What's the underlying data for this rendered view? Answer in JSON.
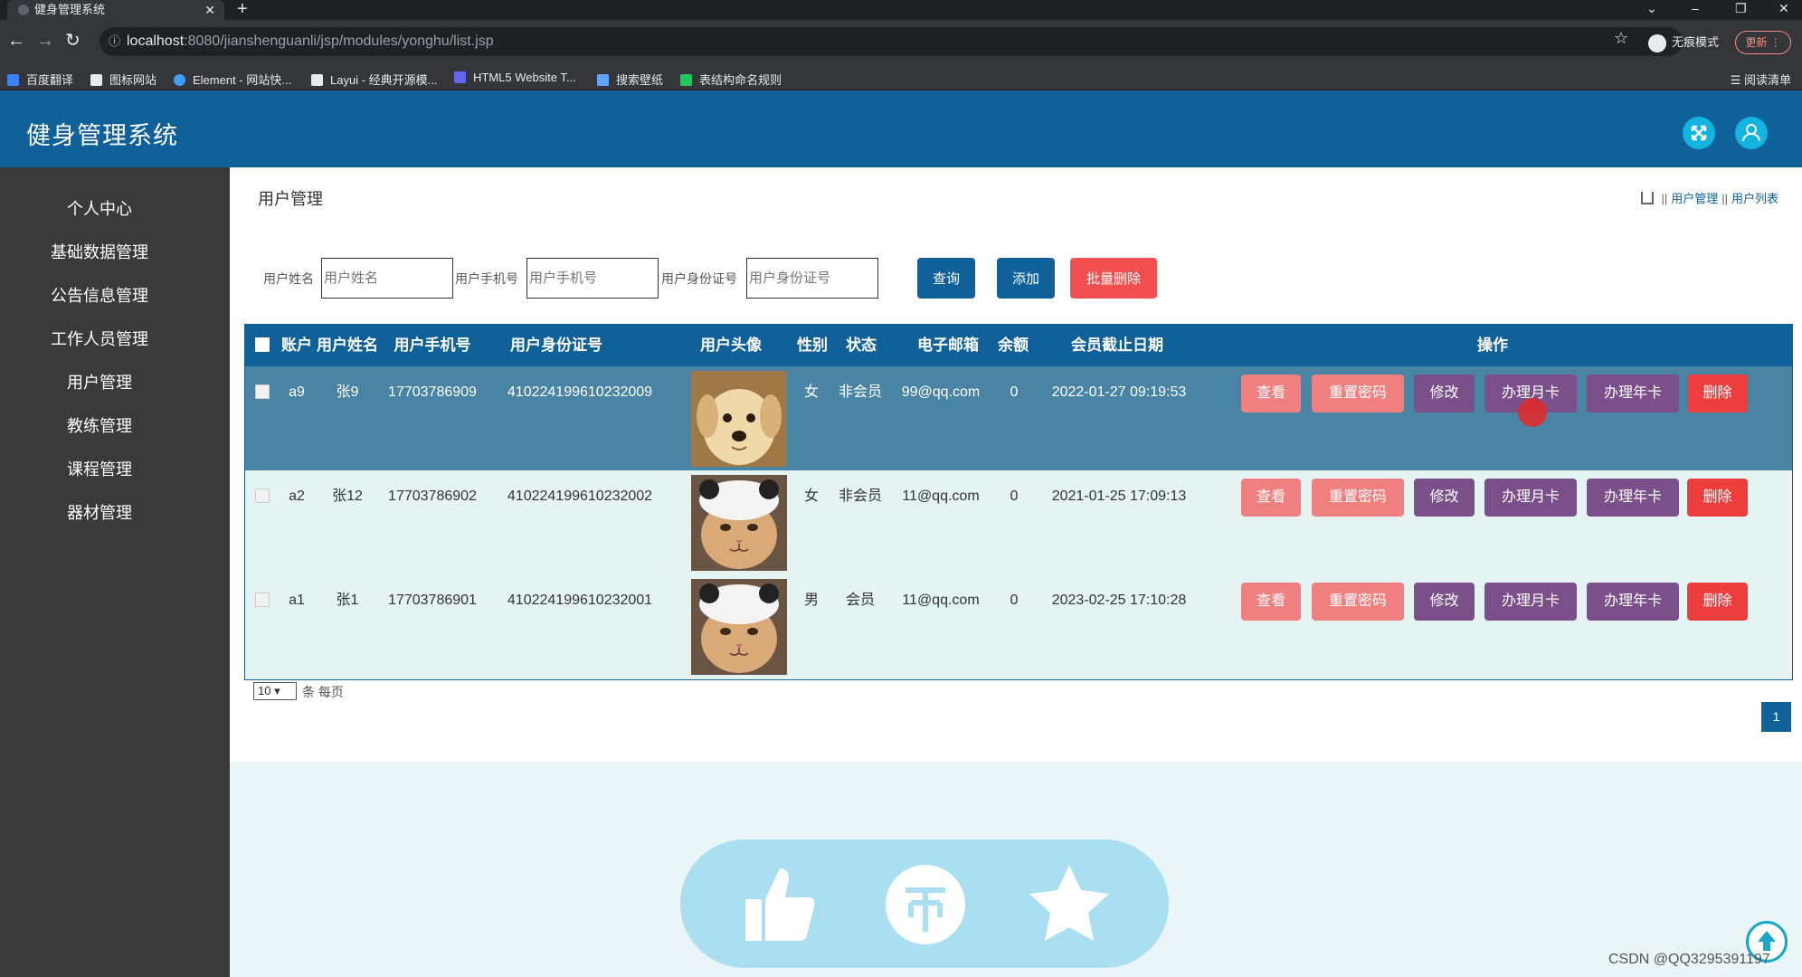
{
  "browser": {
    "tab_title": "健身管理系统",
    "tab_close": "✕",
    "new_tab": "+",
    "url_host": "localhost",
    "url_rest": ":8080/jianshenguanli/jsp/modules/yonghu/list.jsp",
    "incognito_label": "无痕模式",
    "update_label": "更新",
    "bookmarks": [
      "百度翻译",
      "图标网站",
      "Element - 网站快...",
      "Layui - 经典开源模...",
      "HTML5 Website T...",
      "搜索壁纸",
      "表结构命名规则"
    ],
    "reading_list": "阅读清单"
  },
  "app": {
    "title": "健身管理系统"
  },
  "sidebar": {
    "items": [
      {
        "label": "个人中心"
      },
      {
        "label": "基础数据管理"
      },
      {
        "label": "公告信息管理"
      },
      {
        "label": "工作人员管理"
      },
      {
        "label": "用户管理"
      },
      {
        "label": "教练管理"
      },
      {
        "label": "课程管理"
      },
      {
        "label": "器材管理"
      }
    ]
  },
  "page": {
    "title": "用户管理",
    "breadcrumb": [
      "用户管理",
      "用户列表"
    ]
  },
  "search": {
    "name_label": "用户姓名",
    "name_placeholder": "用户姓名",
    "phone_label": "用户手机号",
    "phone_placeholder": "用户手机号",
    "id_label": "用户身份证号",
    "id_placeholder": "用户身份证号",
    "query_button": "查询",
    "add_button": "添加",
    "batch_delete_button": "批量删除"
  },
  "table": {
    "headers": [
      "账户",
      "用户姓名",
      "用户手机号",
      "用户身份证号",
      "用户头像",
      "性别",
      "状态",
      "电子邮箱",
      "余额",
      "会员截止日期",
      "操作"
    ],
    "actions": [
      "查看",
      "重置密码",
      "修改",
      "办理月卡",
      "办理年卡",
      "删除"
    ],
    "rows": [
      {
        "account": "a9",
        "name": "张9",
        "phone": "17703786909",
        "id_card": "410224199610232009",
        "avatar": "puppy",
        "gender": "女",
        "status": "非会员",
        "email": "99@qq.com",
        "balance": "0",
        "expire": "2022-01-27 09:19:53"
      },
      {
        "account": "a2",
        "name": "张12",
        "phone": "17703786902",
        "id_card": "410224199610232002",
        "avatar": "cat",
        "gender": "女",
        "status": "非会员",
        "email": "11@qq.com",
        "balance": "0",
        "expire": "2021-01-25 17:09:13"
      },
      {
        "account": "a1",
        "name": "张1",
        "phone": "17703786901",
        "id_card": "410224199610232001",
        "avatar": "cat",
        "gender": "男",
        "status": "会员",
        "email": "11@qq.com",
        "balance": "0",
        "expire": "2023-02-25 17:10:28"
      }
    ]
  },
  "pagination": {
    "page_size": "10",
    "per_page_label": "条 每页",
    "current_page": "1"
  },
  "watermark": "CSDN @QQ3295391197",
  "colors": {
    "header": "#10609a",
    "sidebar": "#3a3a3a",
    "active_row": "#4a84a4",
    "danger": "#ee3d3d",
    "pink": "#f08080",
    "purple": "#7a4f8a"
  }
}
